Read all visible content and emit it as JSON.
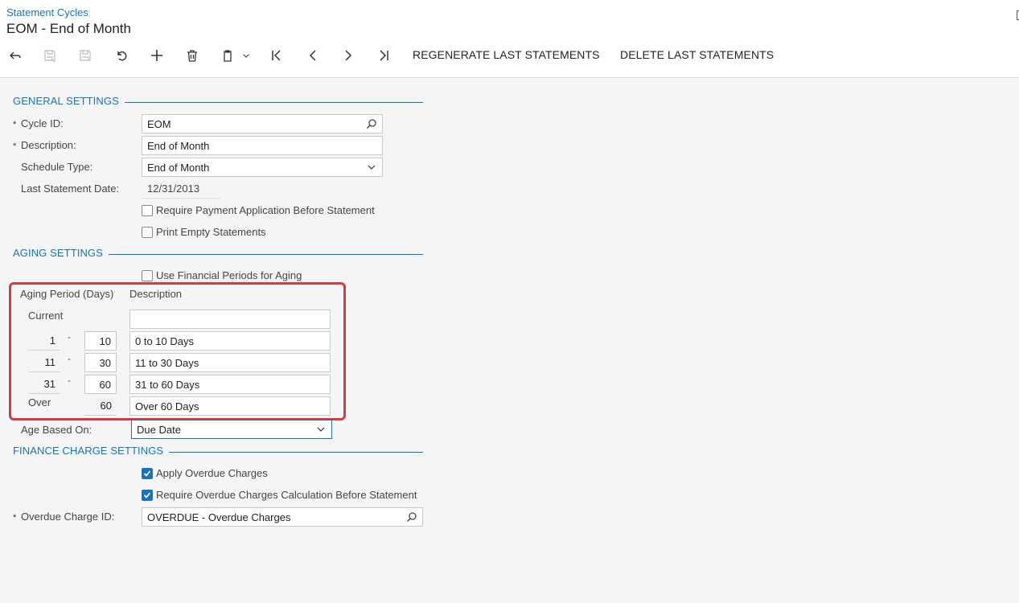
{
  "header": {
    "breadcrumb": "Statement Cycles",
    "title": "EOM - End of Month"
  },
  "toolbar": {
    "regenerate_label": "REGENERATE LAST STATEMENTS",
    "delete_label": "DELETE LAST STATEMENTS"
  },
  "general": {
    "heading": "GENERAL SETTINGS",
    "cycle_id_label": "Cycle ID:",
    "cycle_id_value": "EOM",
    "description_label": "Description:",
    "description_value": "End of Month",
    "schedule_type_label": "Schedule Type:",
    "schedule_type_value": "End of Month",
    "last_statement_label": "Last Statement Date:",
    "last_statement_value": "12/31/2013",
    "require_payment_label": "Require Payment Application Before Statement",
    "require_payment_checked": false,
    "print_empty_label": "Print Empty Statements",
    "print_empty_checked": false
  },
  "aging": {
    "heading": "AGING SETTINGS",
    "use_financial_label": "Use Financial Periods for Aging",
    "use_financial_checked": false,
    "period_header": "Aging Period (Days)",
    "description_header": "Description",
    "current_label": "Current",
    "current_description": "",
    "rows": [
      {
        "from": "1",
        "to": "10",
        "description": "0 to 10 Days"
      },
      {
        "from": "11",
        "to": "30",
        "description": "11 to 30 Days"
      },
      {
        "from": "31",
        "to": "60",
        "description": "31 to 60 Days"
      }
    ],
    "dash": "-",
    "over_label": "Over",
    "over_value": "60",
    "over_description": "Over 60 Days",
    "age_based_label": "Age Based On:",
    "age_based_value": "Due Date"
  },
  "finance": {
    "heading": "FINANCE CHARGE SETTINGS",
    "apply_overdue_label": "Apply Overdue Charges",
    "apply_overdue_checked": true,
    "require_overdue_label": "Require Overdue Charges Calculation Before Statement",
    "require_overdue_checked": true,
    "overdue_id_label": "Overdue Charge ID:",
    "overdue_id_value": "OVERDUE - Overdue Charges"
  },
  "required_marker": "*",
  "colors": {
    "accent": "#1a73b7",
    "highlight": "#d93b3b",
    "background": "#f4f5f6"
  }
}
